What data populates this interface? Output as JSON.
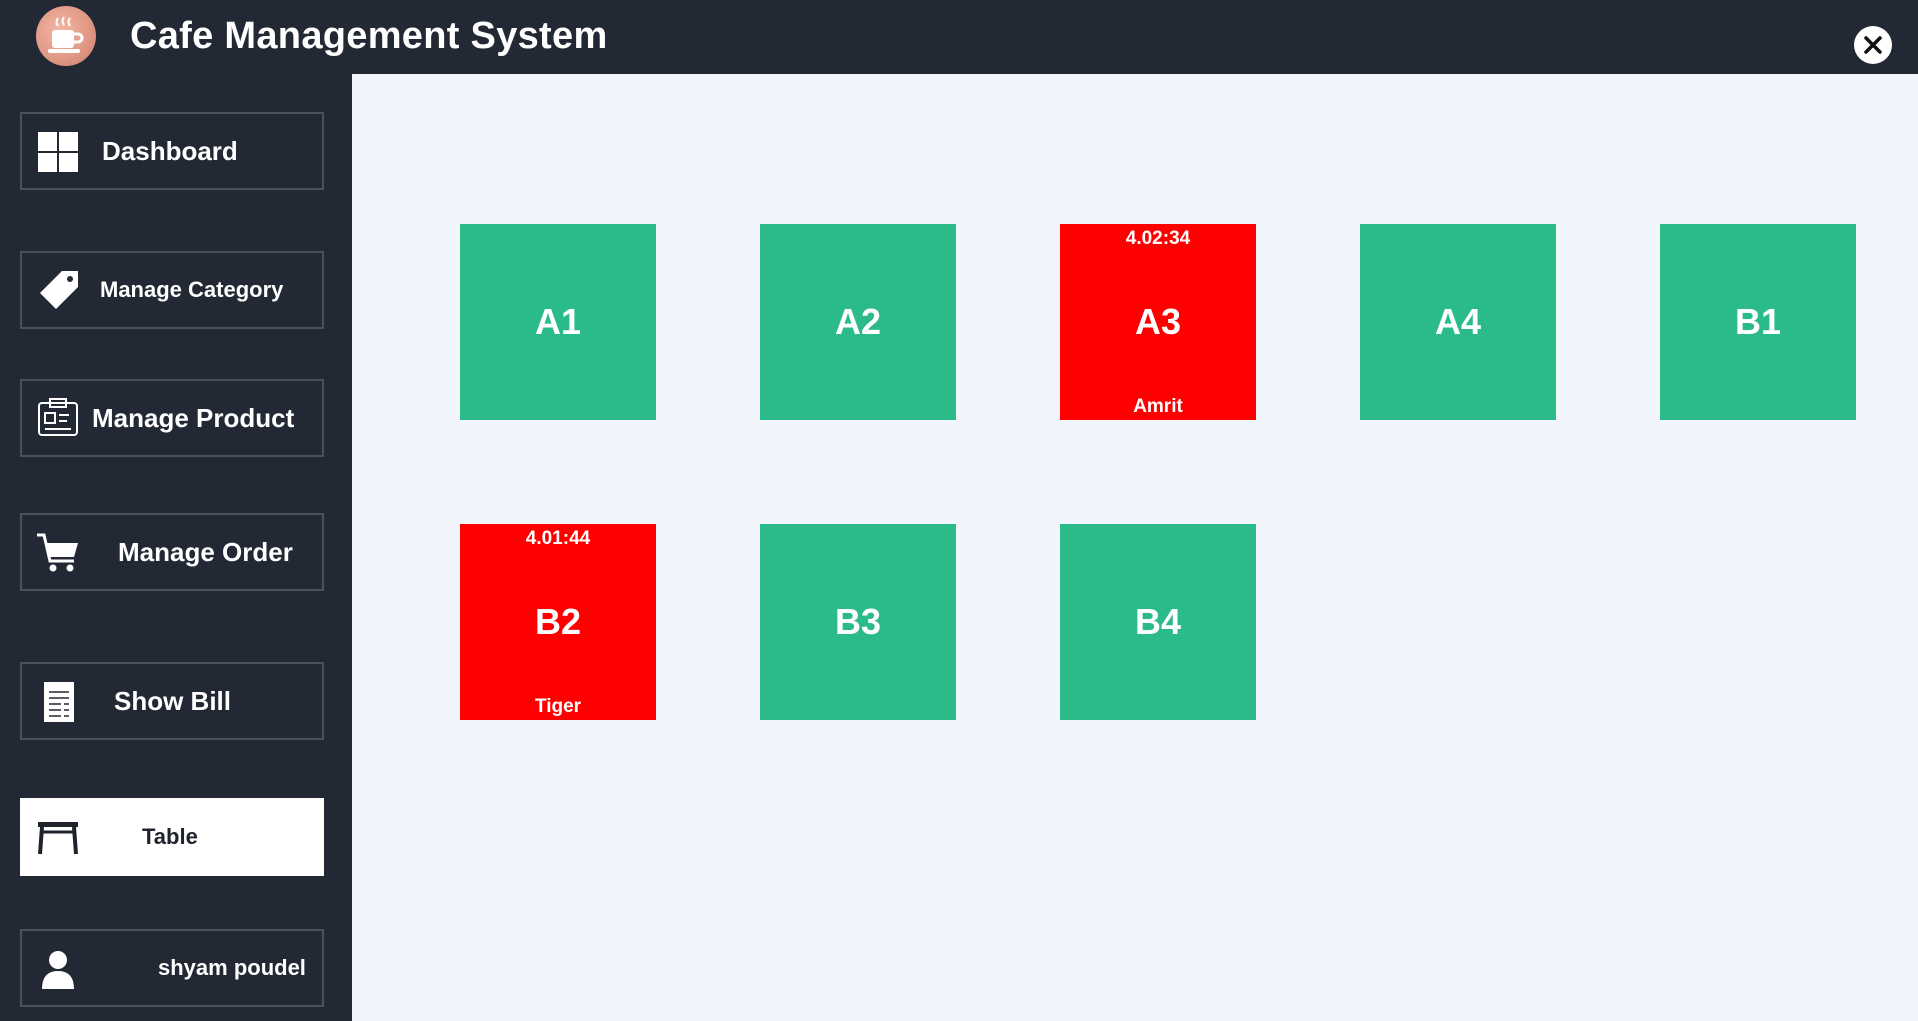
{
  "app": {
    "title": "Cafe Management System",
    "logo_icon": "coffee-cup-icon",
    "close_icon": "close-icon"
  },
  "sidebar": {
    "items": [
      {
        "label": "Dashboard",
        "icon": "dashboard-grid-icon",
        "active": false
      },
      {
        "label": "Manage Category",
        "icon": "tag-icon",
        "active": false
      },
      {
        "label": "Manage Product",
        "icon": "product-box-icon",
        "active": false
      },
      {
        "label": "Manage Order",
        "icon": "cart-icon",
        "active": false
      },
      {
        "label": "Show Bill",
        "icon": "bill-icon",
        "active": false
      },
      {
        "label": "Table",
        "icon": "table-icon",
        "active": true
      },
      {
        "label": "shyam poudel",
        "icon": "user-icon",
        "active": false
      }
    ]
  },
  "tables": [
    {
      "name": "A1",
      "status": "available",
      "time": "",
      "customer": ""
    },
    {
      "name": "A2",
      "status": "available",
      "time": "",
      "customer": ""
    },
    {
      "name": "A3",
      "status": "occupied",
      "time": "4.02:34",
      "customer": "Amrit"
    },
    {
      "name": "A4",
      "status": "available",
      "time": "",
      "customer": ""
    },
    {
      "name": "B1",
      "status": "available",
      "time": "",
      "customer": ""
    },
    {
      "name": "B2",
      "status": "occupied",
      "time": "4.01:44",
      "customer": "Tiger"
    },
    {
      "name": "B3",
      "status": "available",
      "time": "",
      "customer": ""
    },
    {
      "name": "B4",
      "status": "available",
      "time": "",
      "customer": ""
    }
  ],
  "colors": {
    "available": "#2bbb8b",
    "occupied": "#ff0000",
    "sidebar_bg": "#222834",
    "main_bg": "#f1f5fb"
  }
}
